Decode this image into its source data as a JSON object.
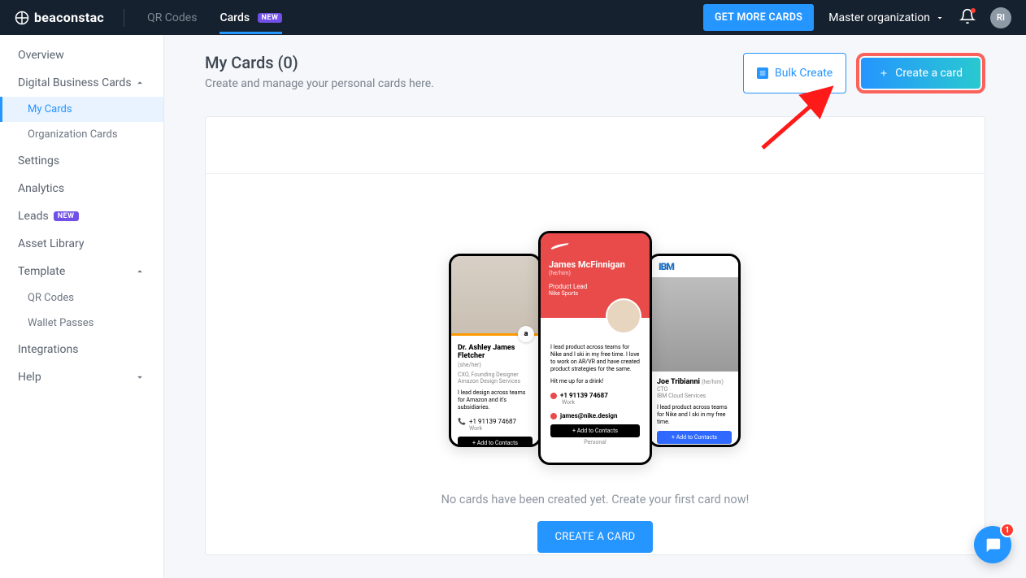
{
  "brand": "beaconstac",
  "topnav": {
    "qr": "QR Codes",
    "cards": "Cards",
    "new_badge": "NEW"
  },
  "topbar": {
    "getmore": "GET MORE CARDS",
    "org": "Master organization",
    "avatar": "RI"
  },
  "sidebar": {
    "overview": "Overview",
    "dbc": "Digital Business Cards",
    "mycards": "My Cards",
    "orgcards": "Organization Cards",
    "settings": "Settings",
    "analytics": "Analytics",
    "leads": "Leads",
    "assetlib": "Asset Library",
    "template": "Template",
    "tmpl_qr": "QR Codes",
    "tmpl_wallet": "Wallet Passes",
    "integrations": "Integrations",
    "help": "Help"
  },
  "page": {
    "title": "My Cards (0)",
    "subtitle": "Create and manage your personal cards here.",
    "bulk": "Bulk Create",
    "create": "Create a card",
    "nocards": "No cards have been created yet. Create your first card now!",
    "create_big": "CREATE A CARD"
  },
  "mock": {
    "left": {
      "name": "Dr. Ashley James Fletcher",
      "pron": "(she/her)",
      "role": "CXO, Founding Designer",
      "org": "Amazon Design Services",
      "desc": "I lead design across teams for Amazon and it's subsidiaries.",
      "phone": "+1 91139 74687",
      "sub": "Work",
      "btn": "+ Add to Contacts",
      "badge": "a"
    },
    "mid": {
      "name": "James McFinnigan",
      "pron": "(he/him)",
      "role": "Product Lead",
      "org": "Nike Sports",
      "desc": "I lead product across teams for Nike and I ski in my free time. I love to work on AR/VR and have created product strategies for the same.",
      "hit": "Hit me up for a drink!",
      "phone": "+1 91139 74687",
      "sub": "Work",
      "email": "james@nike.design",
      "btn": "+ Add to Contacts",
      "personal": "Personal"
    },
    "right": {
      "brand": "IBM",
      "name": "Joe Tribianni",
      "pron": "(he/him)",
      "role": "CTO",
      "org": "IBM Cloud Services",
      "desc": "I lead product across teams for Nike and I ski in my free time.",
      "btn": "+ Add to Contacts"
    }
  },
  "chat_badge": "1"
}
